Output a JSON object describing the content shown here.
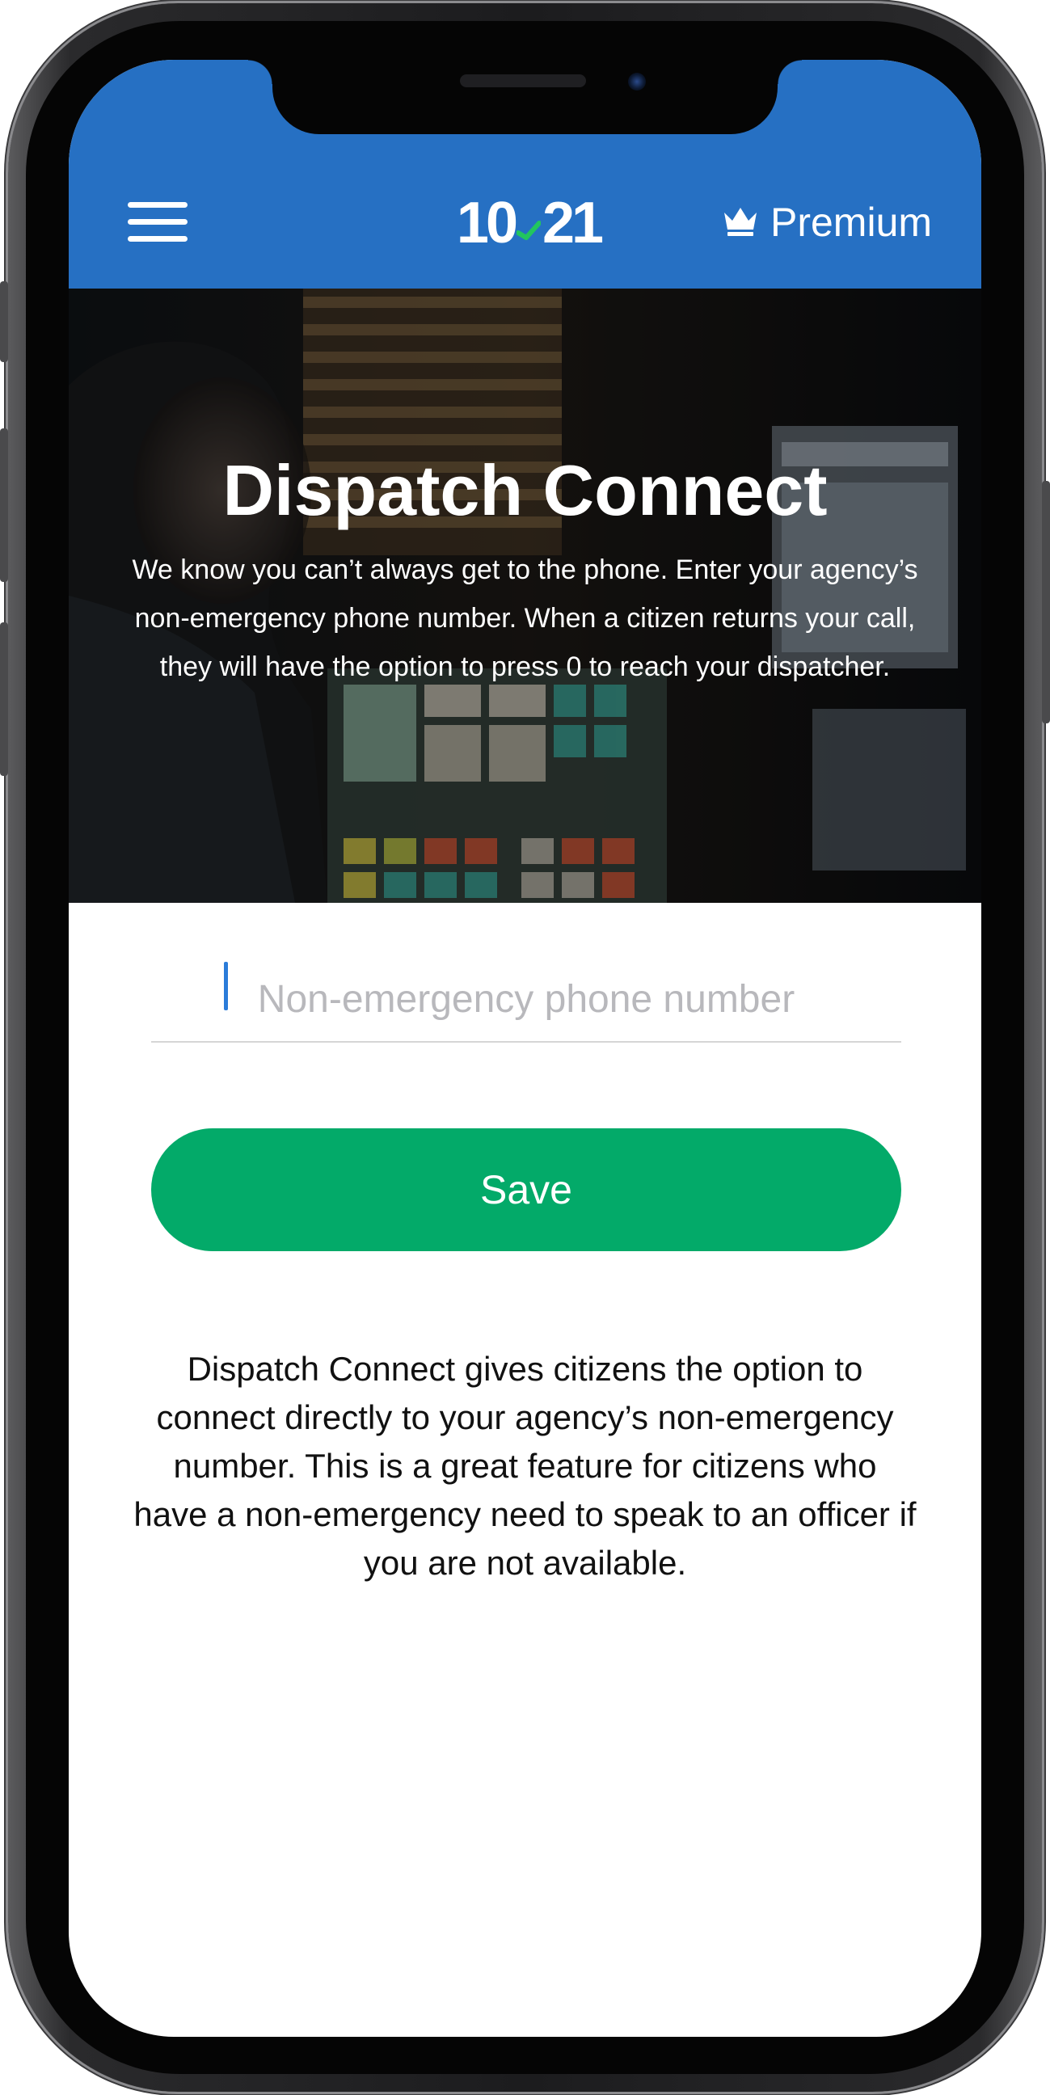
{
  "header": {
    "logo_text_left": "10",
    "logo_text_right": "21",
    "premium_label": "Premium",
    "background_color": "#2670c3"
  },
  "hero": {
    "title": "Dispatch Connect",
    "description": "We know you can’t always get to the phone. Enter your agency’s non-emergency phone number. When a citizen returns your call, they will have the option to press 0 to reach your dispatcher."
  },
  "form": {
    "phone_field": {
      "placeholder": "Non-emergency phone number",
      "value": ""
    },
    "save_label": "Save",
    "save_color": "#03aa69"
  },
  "info": {
    "text": "Dispatch Connect gives citizens the option to connect directly to your agency’s non-emergency number. This is a great feature for citizens who have a non-emergency need to speak to an officer if you are not available."
  },
  "icons": {
    "menu": "hamburger-menu-icon",
    "premium": "crown-icon",
    "logo_mark": "check-swoosh-icon"
  }
}
